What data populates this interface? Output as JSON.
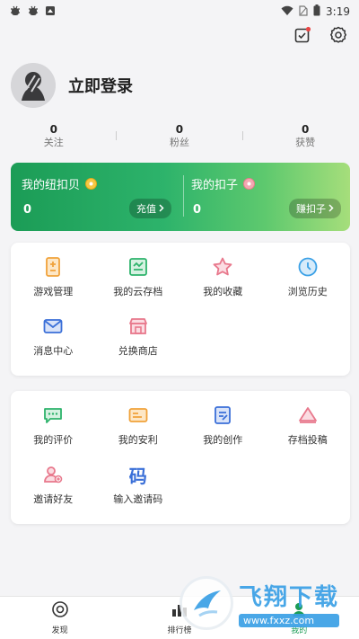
{
  "status_bar": {
    "time": "3:19"
  },
  "profile": {
    "login_text": "立即登录"
  },
  "stats": [
    {
      "value": "0",
      "label": "关注"
    },
    {
      "value": "0",
      "label": "粉丝"
    },
    {
      "value": "0",
      "label": "获赞"
    }
  ],
  "wallet": {
    "left": {
      "title": "我的纽扣贝",
      "value": "0",
      "button": "充值"
    },
    "right": {
      "title": "我的扣子",
      "value": "0",
      "button": "赚扣子"
    }
  },
  "section1": [
    {
      "label": "游戏管理",
      "icon": "game-manage-icon",
      "color": "#f0a23a"
    },
    {
      "label": "我的云存档",
      "icon": "cloud-save-icon",
      "color": "#2db36b"
    },
    {
      "label": "我的收藏",
      "icon": "star-icon",
      "color": "#e8788c"
    },
    {
      "label": "浏览历史",
      "icon": "clock-icon",
      "color": "#3aa0e6"
    },
    {
      "label": "消息中心",
      "icon": "mail-icon",
      "color": "#3a6fd8"
    },
    {
      "label": "兑换商店",
      "icon": "shop-icon",
      "color": "#e8788c"
    }
  ],
  "section2": [
    {
      "label": "我的评价",
      "icon": "comment-icon",
      "color": "#2db36b"
    },
    {
      "label": "我的安利",
      "icon": "card-icon",
      "color": "#f0a23a"
    },
    {
      "label": "我的创作",
      "icon": "edit-doc-icon",
      "color": "#3a6fd8"
    },
    {
      "label": "存档投稿",
      "icon": "submit-icon",
      "color": "#e8788c"
    },
    {
      "label": "邀请好友",
      "icon": "invite-user-icon",
      "color": "#e8788c"
    },
    {
      "label": "输入邀请码",
      "icon": "code-icon",
      "glyph": "码",
      "color": "#3a6fd8"
    }
  ],
  "tabbar": [
    {
      "label": "发现",
      "icon": "discover-icon"
    },
    {
      "label": "排行榜",
      "icon": "ranking-icon"
    },
    {
      "label": "我的",
      "icon": "profile-icon",
      "active": true
    }
  ],
  "watermark": {
    "title": "飞翔下载",
    "url": "www.fxxz.com"
  },
  "colors": {
    "accent": "#1b9c56",
    "background": "#f4f4f6"
  }
}
